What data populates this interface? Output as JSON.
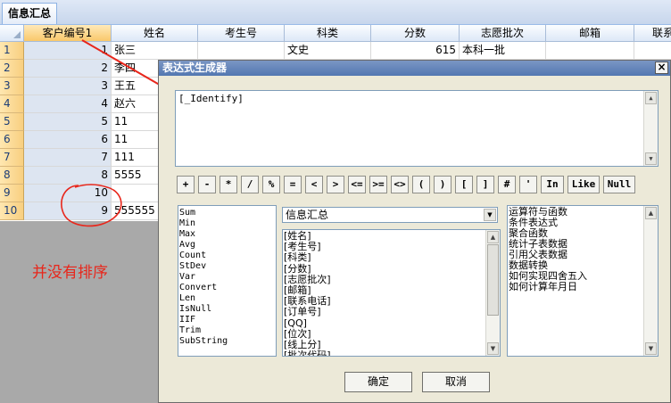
{
  "tab": {
    "label": "信息汇总"
  },
  "grid": {
    "columns": [
      "客户编号1",
      "姓名",
      "考生号",
      "科类",
      "分数",
      "志愿批次",
      "邮箱",
      "联系"
    ],
    "rows": [
      {
        "num": "1",
        "id": "1",
        "name": "张三",
        "kelei": "文史",
        "score": "615",
        "pici": "本科一批"
      },
      {
        "num": "2",
        "id": "2",
        "name": "李四"
      },
      {
        "num": "3",
        "id": "3",
        "name": "王五"
      },
      {
        "num": "4",
        "id": "4",
        "name": "赵六"
      },
      {
        "num": "5",
        "id": "5",
        "name": "11"
      },
      {
        "num": "6",
        "id": "6",
        "name": "11"
      },
      {
        "num": "7",
        "id": "7",
        "name": "111"
      },
      {
        "num": "8",
        "id": "8",
        "name": "5555"
      },
      {
        "num": "9",
        "id": "10",
        "name": ""
      },
      {
        "num": "10",
        "id": "9",
        "name": "555555"
      }
    ]
  },
  "annotation": {
    "text": "并没有排序",
    "color": "#e8261b"
  },
  "dialog": {
    "title": "表达式生成器",
    "close_label": "×",
    "expression": "[_Identify]",
    "operators": [
      "+",
      "-",
      "*",
      "/",
      "%",
      "=",
      "<",
      ">",
      "<=",
      ">=",
      "<>",
      "(",
      ")",
      "[",
      "]",
      "#",
      "'",
      "In",
      "Like",
      "Null"
    ],
    "functions": [
      "Sum",
      "Min",
      "Max",
      "Avg",
      "Count",
      "StDev",
      "Var",
      "Convert",
      "Len",
      "IsNull",
      "IIF",
      "Trim",
      "SubString"
    ],
    "table_select": "信息汇总",
    "fields": [
      "[姓名]",
      "[考生号]",
      "[科类]",
      "[分数]",
      "[志愿批次]",
      "[邮箱]",
      "[联系电话]",
      "[订单号]",
      "[QQ]",
      "[位次]",
      "[线上分]",
      "[批次代码]"
    ],
    "help_topics": [
      "运算符与函数",
      "条件表达式",
      "聚合函数",
      "统计子表数据",
      "引用父表数据",
      "数据转换",
      "如何实现四舍五入",
      "如何计算年月日"
    ],
    "ok_label": "确定",
    "cancel_label": "取消"
  }
}
